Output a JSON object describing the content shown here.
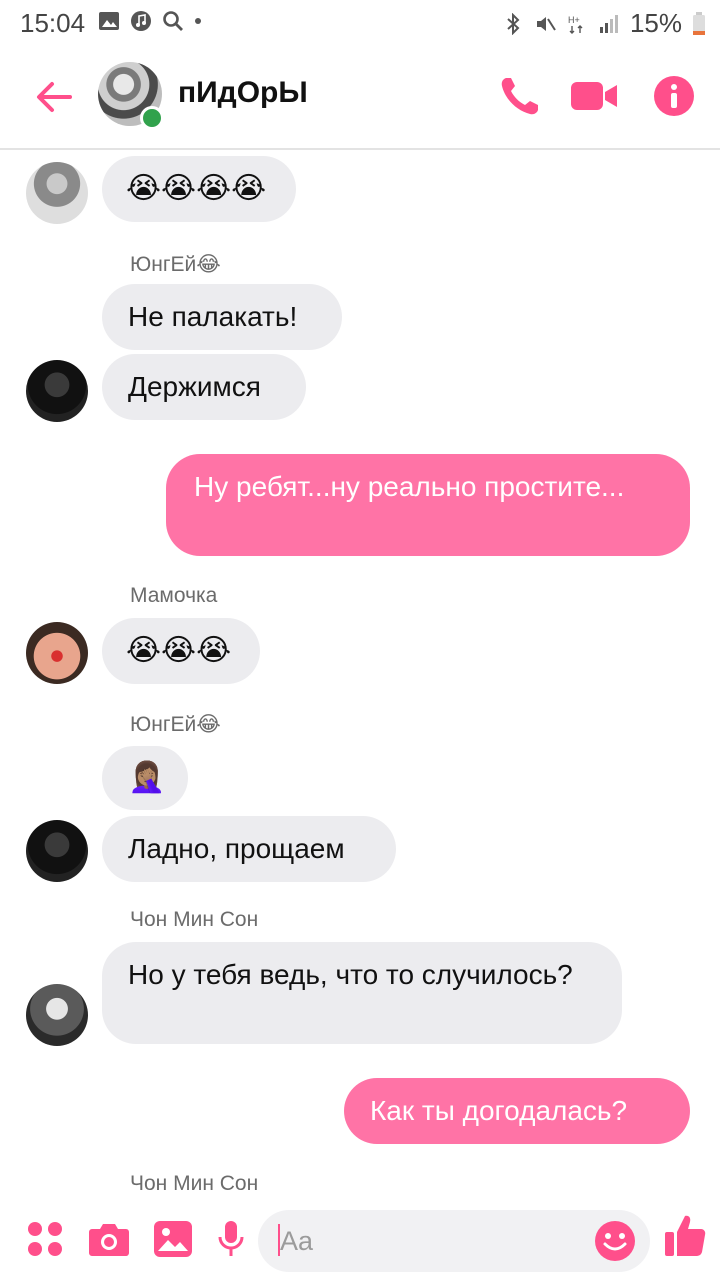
{
  "status_bar": {
    "time": "15:04",
    "battery": "15%"
  },
  "header": {
    "title": "пИдОрЫ"
  },
  "colors": {
    "accent": "#ff4f8b",
    "outgoing_bubble": "#ff73a6",
    "incoming_bubble": "#ececef",
    "online": "#31a24c"
  },
  "messages": [
    {
      "sender": "",
      "text": "😭😭😭😭",
      "direction": "in"
    },
    {
      "sender": "ЮнгЕй😂",
      "text": "Не палакать!",
      "direction": "in"
    },
    {
      "sender": "",
      "text": "Держимся",
      "direction": "in"
    },
    {
      "sender": "",
      "text": "Ну ребят...ну реально простите...",
      "direction": "out"
    },
    {
      "sender": "Мамочка",
      "text": "😭😭😭",
      "direction": "in"
    },
    {
      "sender": "ЮнгЕй😂",
      "text": "🤦🏽‍♀️",
      "direction": "in"
    },
    {
      "sender": "",
      "text": "Ладно, прощаем",
      "direction": "in"
    },
    {
      "sender": "Чон Мин Сон",
      "text": "Но у тебя ведь, что то случилось?",
      "direction": "in"
    },
    {
      "sender": "",
      "text": "Как ты догодалась?",
      "direction": "out"
    },
    {
      "sender": "Чон Мин Сон",
      "text": "",
      "direction": "in"
    }
  ],
  "composer": {
    "placeholder": "Aa"
  },
  "icons": [
    "back-arrow-icon",
    "phone-icon",
    "video-camera-icon",
    "info-icon",
    "apps-icon",
    "camera-icon",
    "gallery-icon",
    "microphone-icon",
    "emoji-icon",
    "thumbs-up-icon"
  ]
}
